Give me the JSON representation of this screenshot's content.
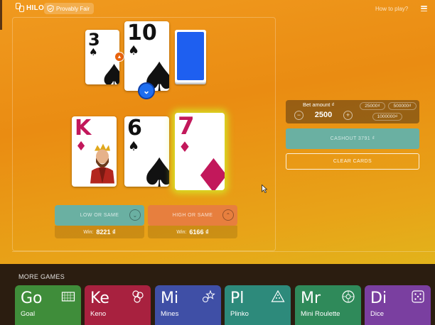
{
  "header": {
    "logo_text": "HILO",
    "provably_fair": "Provably Fair",
    "how_to_play": "How to play?"
  },
  "cards": {
    "prev_top_1": {
      "rank": "3",
      "suit": "♠",
      "color": "black"
    },
    "current": {
      "rank": "10",
      "suit": "♠",
      "color": "black"
    },
    "history_1": {
      "rank": "K",
      "suit": "♦",
      "color": "red"
    },
    "history_2": {
      "rank": "6",
      "suit": "♠",
      "color": "black"
    },
    "history_3": {
      "rank": "7",
      "suit": "♦",
      "color": "red"
    }
  },
  "buttons": {
    "low": "LOW OR SAME",
    "high": "HIGH OR SAME",
    "low_icon": "chevron-down-icon",
    "high_icon": "chevron-up-icon"
  },
  "wins": {
    "low_label": "Win:",
    "low_value": "8221 ₫",
    "high_label": "Win:",
    "high_value": "6166 ₫"
  },
  "bet": {
    "label": "Bet amount ₫",
    "value": "2500",
    "minus": "−",
    "plus": "+",
    "quick": [
      "25000₫",
      "500000₫",
      "1000000₫"
    ]
  },
  "actions": {
    "cashout": "CASHOUT 3791 ₫",
    "clear": "CLEAR CARDS"
  },
  "more_games": {
    "title": "MORE GAMES",
    "items": [
      {
        "abbr": "Go",
        "name": "Goal",
        "color": "#3f8d3a",
        "icon": "goal-net-icon"
      },
      {
        "abbr": "Ke",
        "name": "Keno",
        "color": "#a8213f",
        "icon": "keno-balls-icon"
      },
      {
        "abbr": "Mi",
        "name": "Mines",
        "color": "#3f4fa6",
        "icon": "stars-icon"
      },
      {
        "abbr": "Pl",
        "name": "Plinko",
        "color": "#2d8a7b",
        "icon": "plinko-triangle-icon"
      },
      {
        "abbr": "Mr",
        "name": "Mini Roulette",
        "color": "#2f8a5a",
        "icon": "roulette-wheel-icon"
      },
      {
        "abbr": "Di",
        "name": "Dice",
        "color": "#7a3fa0",
        "icon": "dice-icon"
      }
    ]
  },
  "colors": {
    "accent_orange": "#ea8c12",
    "teal_button": "#6ab0a2",
    "orange_button": "#e77f3e",
    "card_back_blue": "#1e5ff0",
    "card_red": "#c2185b"
  }
}
